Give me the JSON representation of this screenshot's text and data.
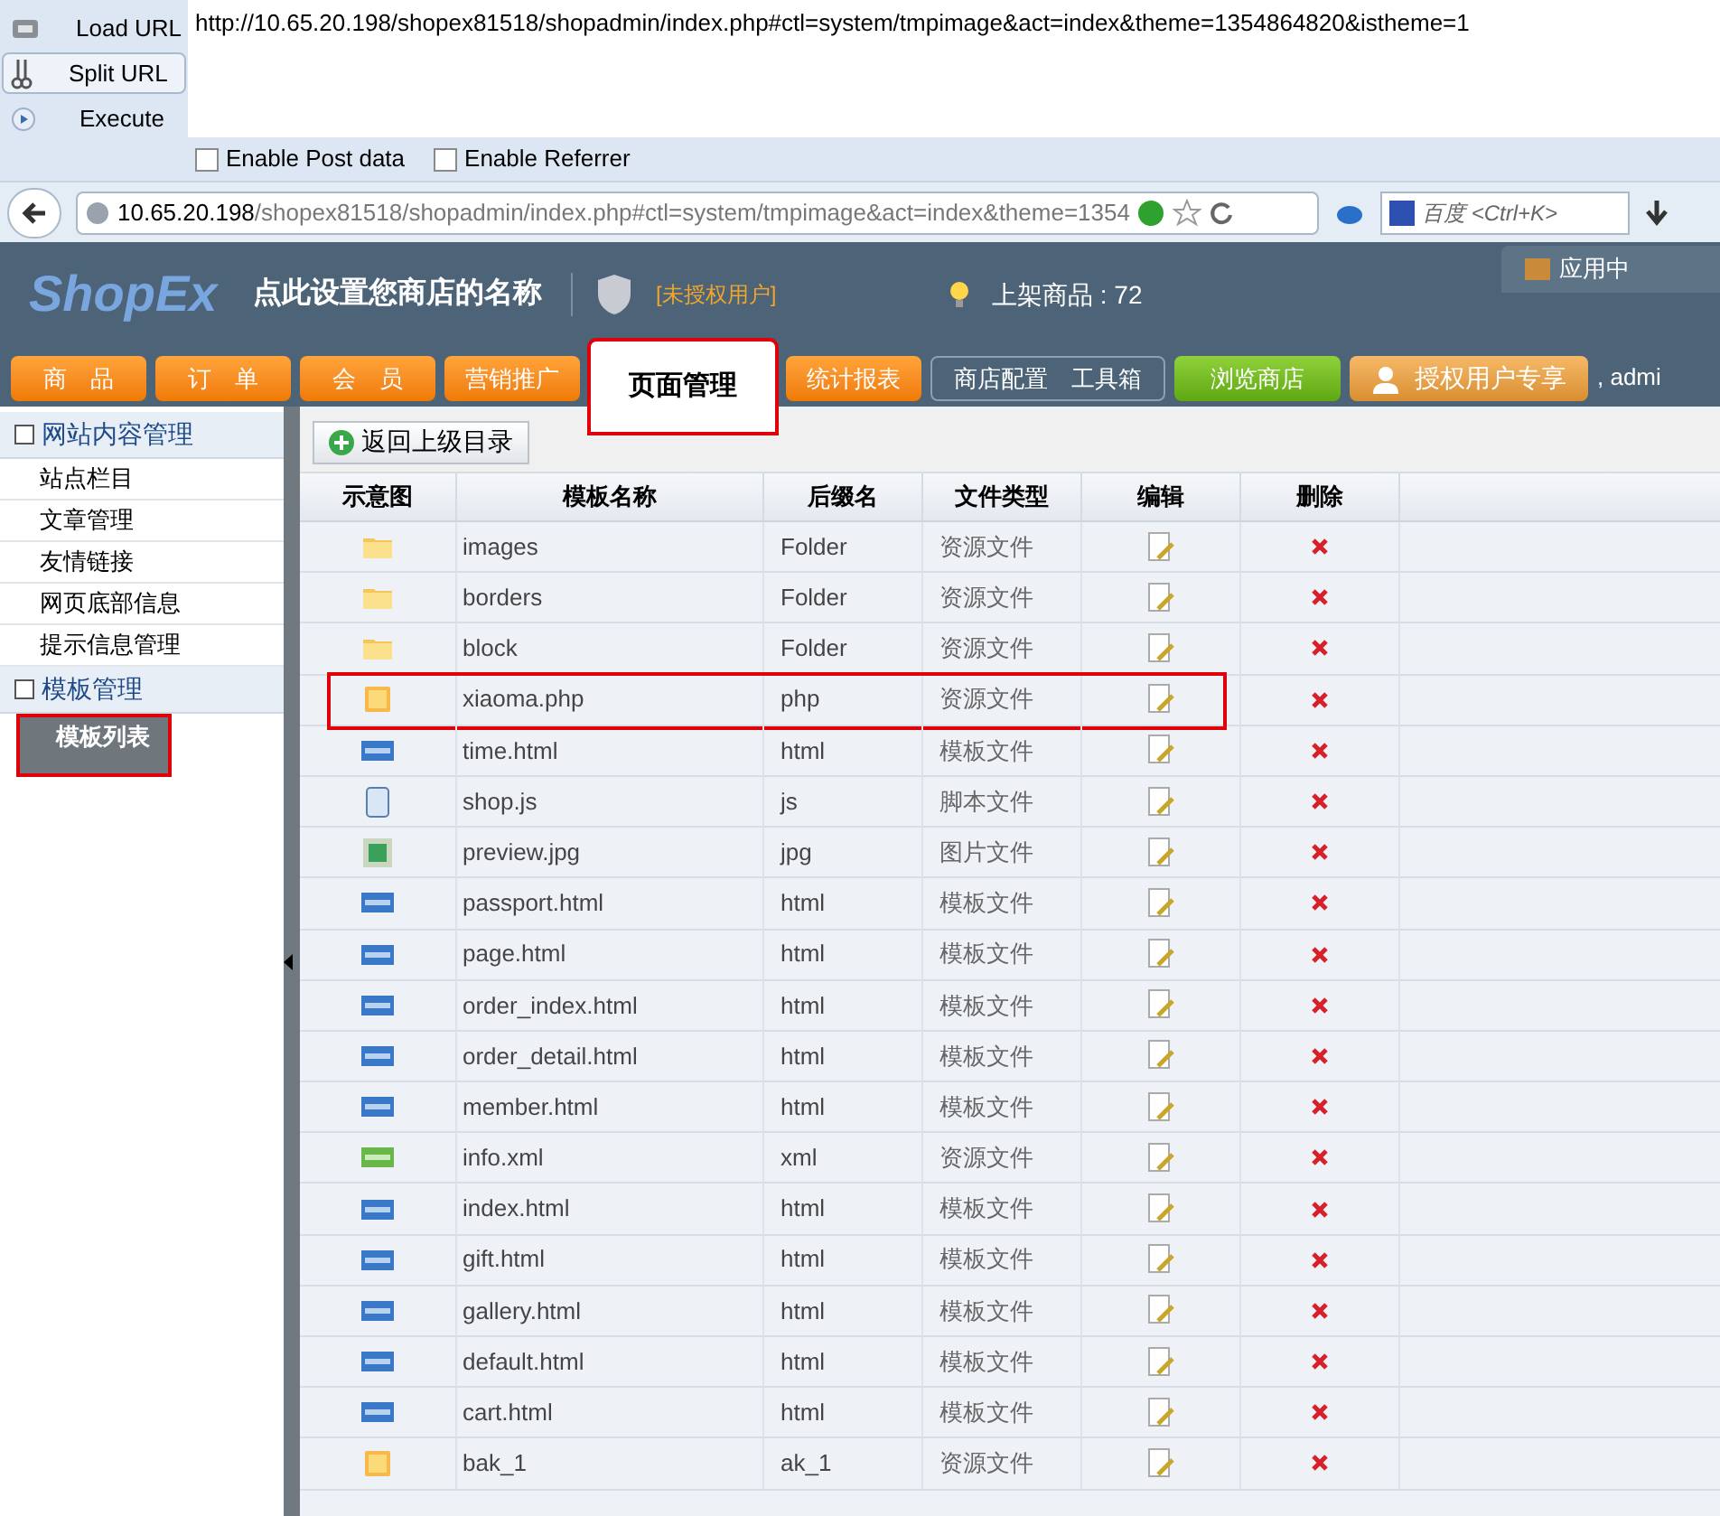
{
  "hackbar": {
    "buttons": [
      {
        "label": "Load URL",
        "kind": "load",
        "selected": false
      },
      {
        "label": "Split URL",
        "kind": "split",
        "selected": true
      },
      {
        "label": "Execute",
        "kind": "execute",
        "selected": false
      }
    ],
    "url": "http://10.65.20.198/shopex81518/shopadmin/index.php#ctl=system/tmpimage&act=index&theme=1354864820&istheme=1",
    "checkboxes": [
      {
        "label": "Enable Post data",
        "checked": false
      },
      {
        "label": "Enable Referrer",
        "checked": false
      }
    ]
  },
  "browser": {
    "host": "10.65.20.198",
    "path": "/shopex81518/shopadmin/index.php#ctl=system/tmpimage&act=index&theme=1354",
    "search_placeholder": "百度 <Ctrl+K>"
  },
  "header": {
    "logo": "ShopEx",
    "store_name": "点此设置您商店的名称",
    "license": "[未授权用户]",
    "products": "上架商品 : 72",
    "app_center": "应用中",
    "greeting": ", admi"
  },
  "tabs": [
    {
      "label": "商　品",
      "kind": "orange",
      "selected": false,
      "annotated": false
    },
    {
      "label": "订　单",
      "kind": "orange",
      "selected": false,
      "annotated": false
    },
    {
      "label": "会　员",
      "kind": "orange",
      "selected": false,
      "annotated": false
    },
    {
      "label": "营销推广",
      "kind": "orange",
      "selected": false,
      "annotated": false
    },
    {
      "label": "页面管理",
      "kind": "orange",
      "selected": true,
      "annotated": true
    },
    {
      "label": "统计报表",
      "kind": "orange",
      "selected": false,
      "annotated": false
    },
    {
      "label": "商店配置　工具箱",
      "kind": "outline",
      "selected": false,
      "annotated": false
    },
    {
      "label": "浏览商店",
      "kind": "green",
      "selected": false,
      "annotated": false
    },
    {
      "label": "授权用户专享",
      "kind": "gold",
      "selected": false,
      "annotated": false
    }
  ],
  "sidebar": {
    "groups": [
      {
        "title": "网站内容管理",
        "items": [
          {
            "label": "站点栏目",
            "selected": false,
            "annotated": false
          },
          {
            "label": "文章管理",
            "selected": false,
            "annotated": false
          },
          {
            "label": "友情链接",
            "selected": false,
            "annotated": false
          },
          {
            "label": "网页底部信息",
            "selected": false,
            "annotated": false
          },
          {
            "label": "提示信息管理",
            "selected": false,
            "annotated": false
          }
        ]
      },
      {
        "title": "模板管理",
        "items": [
          {
            "label": "模板列表",
            "selected": true,
            "annotated": true
          }
        ]
      }
    ]
  },
  "table": {
    "back_button": "返回上级目录",
    "columns": [
      "示意图",
      "模板名称",
      "后缀名",
      "文件类型",
      "编辑",
      "删除"
    ],
    "rows": [
      {
        "kind": "folder",
        "name": "images",
        "ext": "Folder",
        "type": "资源文件",
        "annotated": false
      },
      {
        "kind": "folder",
        "name": "borders",
        "ext": "Folder",
        "type": "资源文件",
        "annotated": false
      },
      {
        "kind": "folder",
        "name": "block",
        "ext": "Folder",
        "type": "资源文件",
        "annotated": false
      },
      {
        "kind": "file",
        "name": "xiaoma.php",
        "ext": "php",
        "type": "资源文件",
        "annotated": true
      },
      {
        "kind": "html",
        "name": "time.html",
        "ext": "html",
        "type": "模板文件",
        "annotated": false
      },
      {
        "kind": "script",
        "name": "shop.js",
        "ext": "js",
        "type": "脚本文件",
        "annotated": false
      },
      {
        "kind": "image",
        "name": "preview.jpg",
        "ext": "jpg",
        "type": "图片文件",
        "annotated": false
      },
      {
        "kind": "html",
        "name": "passport.html",
        "ext": "html",
        "type": "模板文件",
        "annotated": false
      },
      {
        "kind": "html",
        "name": "page.html",
        "ext": "html",
        "type": "模板文件",
        "annotated": false
      },
      {
        "kind": "html",
        "name": "order_index.html",
        "ext": "html",
        "type": "模板文件",
        "annotated": false
      },
      {
        "kind": "html",
        "name": "order_detail.html",
        "ext": "html",
        "type": "模板文件",
        "annotated": false
      },
      {
        "kind": "html",
        "name": "member.html",
        "ext": "html",
        "type": "模板文件",
        "annotated": false
      },
      {
        "kind": "xml",
        "name": "info.xml",
        "ext": "xml",
        "type": "资源文件",
        "annotated": false
      },
      {
        "kind": "html",
        "name": "index.html",
        "ext": "html",
        "type": "模板文件",
        "annotated": false
      },
      {
        "kind": "html",
        "name": "gift.html",
        "ext": "html",
        "type": "模板文件",
        "annotated": false
      },
      {
        "kind": "html",
        "name": "gallery.html",
        "ext": "html",
        "type": "模板文件",
        "annotated": false
      },
      {
        "kind": "html",
        "name": "default.html",
        "ext": "html",
        "type": "模板文件",
        "annotated": false
      },
      {
        "kind": "html",
        "name": "cart.html",
        "ext": "html",
        "type": "模板文件",
        "annotated": false
      },
      {
        "kind": "file",
        "name": "bak_1",
        "ext": "ak_1",
        "type": "资源文件",
        "annotated": false
      }
    ]
  }
}
